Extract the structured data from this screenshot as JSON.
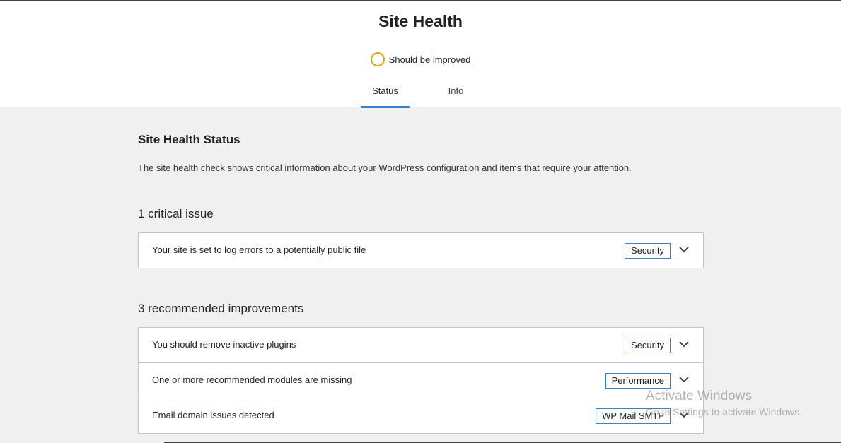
{
  "header": {
    "title": "Site Health",
    "status_text": "Should be improved",
    "status_color": "#dba617",
    "tabs": [
      {
        "label": "Status",
        "active": true
      },
      {
        "label": "Info",
        "active": false
      }
    ]
  },
  "main": {
    "title": "Site Health Status",
    "description": "The site health check shows critical information about your WordPress configuration and items that require your attention.",
    "critical": {
      "heading": "1 critical issue",
      "items": [
        {
          "label": "Your site is set to log errors to a potentially public file",
          "badge": "Security"
        }
      ]
    },
    "recommended": {
      "heading": "3 recommended improvements",
      "items": [
        {
          "label": "You should remove inactive plugins",
          "badge": "Security"
        },
        {
          "label": "One or more recommended modules are missing",
          "badge": "Performance"
        },
        {
          "label": "Email domain issues detected",
          "badge": "WP Mail SMTP"
        }
      ]
    }
  },
  "watermark": {
    "line1": "Activate Windows",
    "line2": "Go to Settings to activate Windows."
  },
  "colors": {
    "accent": "#3582c4",
    "background": "#f0f0f1"
  }
}
